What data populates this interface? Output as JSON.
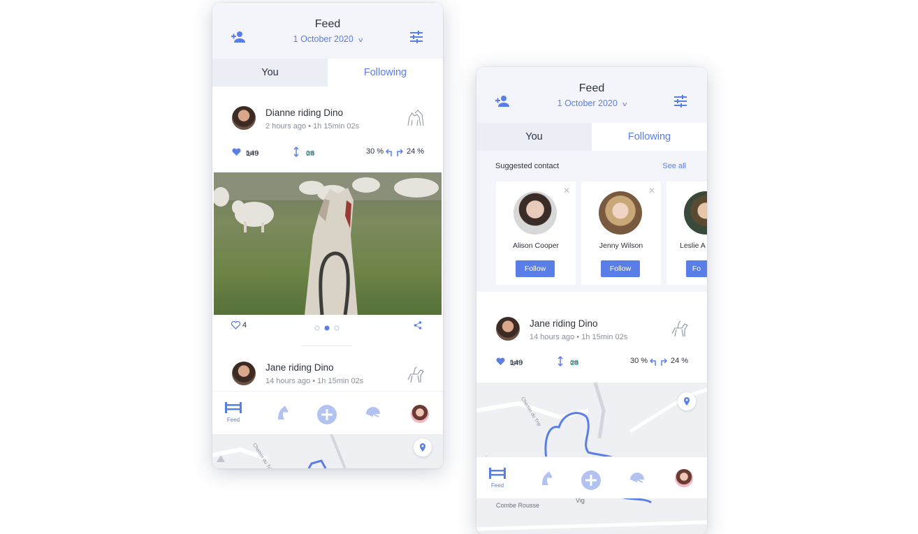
{
  "phone1": {
    "header": {
      "title": "Feed",
      "date": "1 October 2020"
    },
    "tabs": {
      "you": "You",
      "following": "Following"
    },
    "post1": {
      "name": "Dianne riding Dino",
      "meta": "2 hours ago • 1h 15min 02s",
      "bpm": "149",
      "bpm_unit": "bpm",
      "h1": "14",
      "h2": "16",
      "h3": "23",
      "h_unit": "cm",
      "pct_left": "30 %",
      "pct_right": "24 %",
      "likes": "4"
    },
    "post2": {
      "name": "Jane riding Dino",
      "meta": "14 hours ago • 1h 15min 02s"
    },
    "nav": {
      "feed": "Feed"
    },
    "map": {
      "road": "Chemin du Trip"
    }
  },
  "phone2": {
    "header": {
      "title": "Feed",
      "date": "1 October 2020"
    },
    "tabs": {
      "you": "You",
      "following": "Following"
    },
    "suggested": {
      "label": "Suggested contact",
      "see_all": "See all",
      "contacts": [
        {
          "name": "Alison Cooper",
          "button": "Follow"
        },
        {
          "name": "Jenny Wilson",
          "button": "Follow"
        },
        {
          "name": "Leslie A",
          "button": "Fo"
        }
      ]
    },
    "post": {
      "name": "Jane riding Dino",
      "meta": "14 hours ago • 1h 15min 02s",
      "bpm": "149",
      "bpm_unit": "bpm",
      "h1": "14",
      "h2": "16",
      "h3": "23",
      "h_unit": "cm",
      "pct_left": "30 %",
      "pct_right": "24 %"
    },
    "nav": {
      "feed": "Feed"
    },
    "map": {
      "road": "Chemin du Trip",
      "place1": "Combe Rousse",
      "place2": "Vig"
    }
  },
  "colors": {
    "accent": "#5a7ee8",
    "header_bg": "#f4f5fa",
    "orange": "#f0a35a",
    "green": "#4fc0a8"
  }
}
